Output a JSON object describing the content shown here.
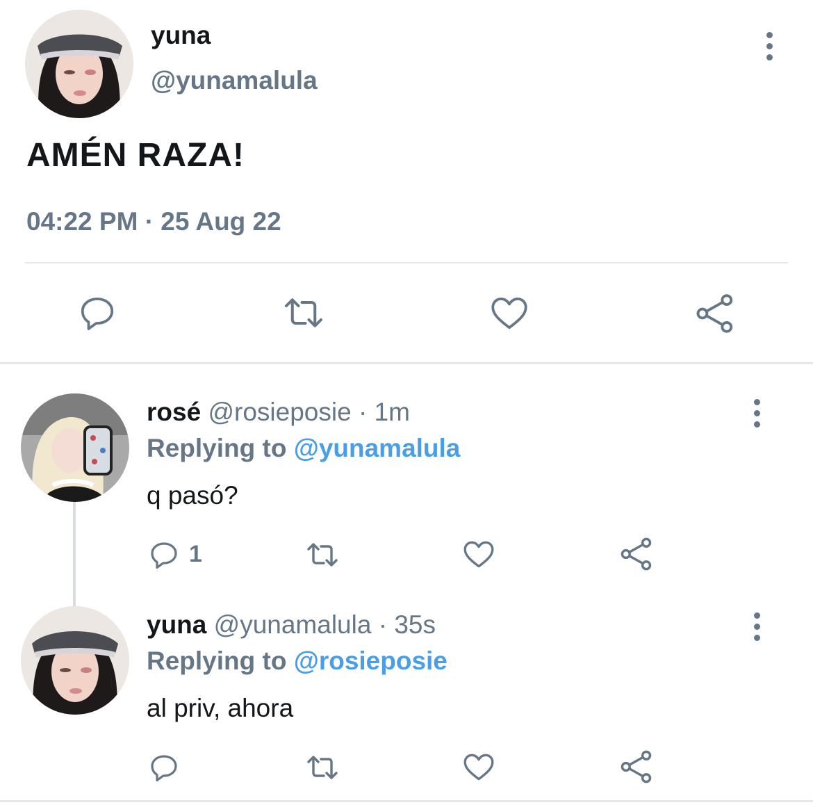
{
  "main_tweet": {
    "display_name": "yuna",
    "handle": "@yunamalula",
    "text": "AMÉN RAZA!",
    "timestamp": "04:22 PM · 25 Aug 22",
    "actions": {
      "reply_icon": "reply-icon",
      "retweet_icon": "retweet-icon",
      "like_icon": "heart-icon",
      "share_icon": "share-icon"
    }
  },
  "replies": [
    {
      "display_name": "rosé",
      "handle": "@rosieposie",
      "time": "1m",
      "replying_label": "Replying to",
      "replying_to": "@yunamalula",
      "text": "q pasó?",
      "reply_count": "1"
    },
    {
      "display_name": "yuna",
      "handle": "@yunamalula",
      "time": "35s",
      "replying_label": "Replying to",
      "replying_to": "@rosieposie",
      "text": "al priv, ahora",
      "reply_count": ""
    }
  ],
  "colors": {
    "text": "#14171a",
    "muted": "#657786",
    "link": "#4a9ee6",
    "divider": "#e6e9ec"
  }
}
